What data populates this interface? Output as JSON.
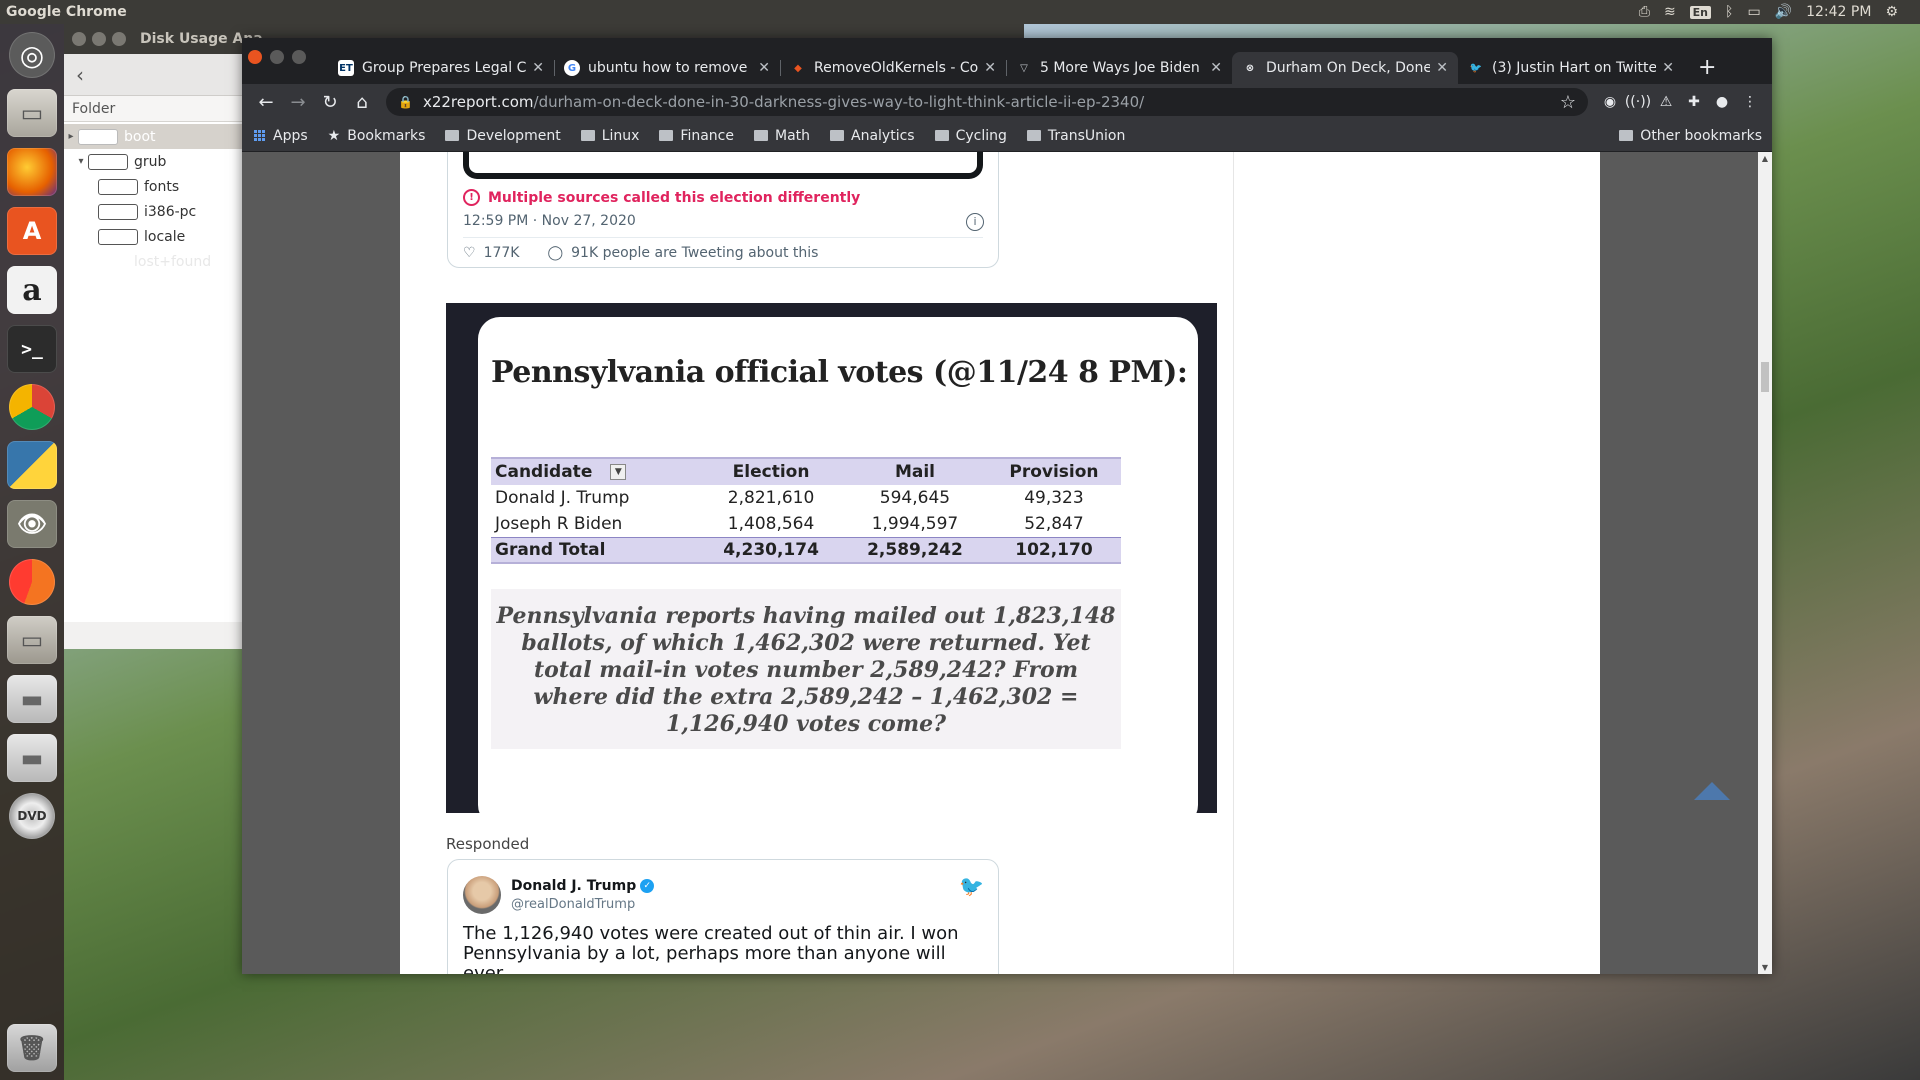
{
  "top_panel": {
    "app_name": "Google Chrome",
    "keyboard_layout": "En",
    "clock": "12:42 PM"
  },
  "launcher": {
    "items": [
      "ubuntu-dash",
      "files",
      "firefox",
      "software-center",
      "amazon",
      "terminal",
      "chrome",
      "python",
      "gimp",
      "chromium",
      "files-2",
      "drive",
      "drive-2",
      "dvd",
      "trash"
    ]
  },
  "bg_window": {
    "title": "Disk Usage Ana",
    "folder_header": "Folder",
    "tree": [
      {
        "label": "boot",
        "selected": true
      },
      {
        "label": "grub",
        "expanded": true
      },
      {
        "label": "fonts"
      },
      {
        "label": "i386-pc"
      },
      {
        "label": "locale"
      },
      {
        "label": "lost+found",
        "faded": true
      }
    ]
  },
  "browser": {
    "tabs": [
      {
        "favicon": "ET",
        "label": "Group Prepares Legal Ch",
        "active": false
      },
      {
        "favicon": "G",
        "label": "ubuntu how to remove o",
        "active": false
      },
      {
        "favicon": "◆",
        "label": "RemoveOldKernels - Cor",
        "active": false
      },
      {
        "favicon": "▽",
        "label": "5 More Ways Joe Biden",
        "active": false
      },
      {
        "favicon": "⊗",
        "label": "Durham On Deck, Done",
        "active": true
      },
      {
        "favicon": "🐦",
        "label": "(3) Justin Hart on Twitte",
        "active": false
      }
    ],
    "url_domain": "x22report.com",
    "url_path": "/durham-on-deck-done-in-30-darkness-gives-way-to-light-think-article-ii-ep-2340/",
    "bookmarks": {
      "apps": "Apps",
      "bookmarks": "Bookmarks",
      "folders": [
        "Development",
        "Linux",
        "Finance",
        "Math",
        "Analytics",
        "Cycling",
        "TransUnion"
      ],
      "other": "Other bookmarks"
    }
  },
  "page": {
    "tweet1": {
      "warning": "Multiple sources called this election differently",
      "timestamp": "12:59 PM · Nov 27, 2020",
      "likes": "177K",
      "tweeting": "91K people are Tweeting about this"
    },
    "figure": {
      "title": "Pennsylvania official votes (@11/24 8 PM):",
      "columns": [
        "Candidate",
        "Election",
        "Mail",
        "Provision"
      ],
      "rows": [
        [
          "Donald J. Trump",
          "2,821,610",
          "594,645",
          "49,323"
        ],
        [
          "Joseph R Biden",
          "1,408,564",
          "1,994,597",
          "52,847"
        ]
      ],
      "total": [
        "Grand Total",
        "4,230,174",
        "2,589,242",
        "102,170"
      ],
      "caption": "Pennsylvania reports having mailed out 1,823,148 ballots, of which 1,462,302 were returned. Yet total mail-in votes number 2,589,242? From where did the extra 2,589,242 – 1,462,302 = 1,126,940 votes come?"
    },
    "responded": "Responded",
    "tweet2": {
      "name": "Donald J. Trump",
      "handle": "@realDonaldTrump",
      "text": "The 1,126,940 votes were created out of thin air. I won Pennsylvania by a lot, perhaps more than anyone will ever"
    }
  }
}
